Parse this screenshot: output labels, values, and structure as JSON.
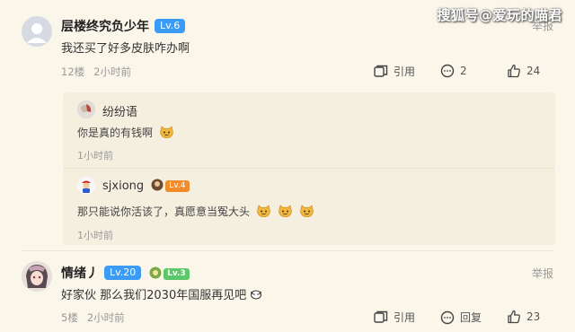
{
  "watermark": "搜狐号@爱玩的喵君",
  "comments": [
    {
      "username": "层楼终究负少年",
      "level": "Lv.6",
      "report": "举报",
      "text": "我还买了好多皮肤咋办啊",
      "floor": "12楼",
      "time": "2小时前",
      "quote_label": "引用",
      "reply_count": "2",
      "likes": "24",
      "replies": [
        {
          "username": "纷纷语",
          "text": "你是真的有钱啊",
          "time": "1小时前"
        },
        {
          "username": "sjxiong",
          "badge": "Lv.4",
          "text": "那只能说你活该了，真愿意当冤大头",
          "time": "1小时前"
        }
      ]
    },
    {
      "username": "情绪丿",
      "level": "Lv.20",
      "badge": "Lv.3",
      "report": "举报",
      "text": "好家伙 那么我们2030年国服再见吧",
      "floor": "5楼",
      "time": "2小时前",
      "quote_label": "引用",
      "reply_label": "回复",
      "likes": "23"
    }
  ],
  "colors": {
    "background": "#fbf6ea",
    "reply_box": "#f5efe0",
    "level_badge": "#3b9bf5",
    "green_badge": "#5cc86a",
    "orange_badge": "#f28b2a"
  }
}
